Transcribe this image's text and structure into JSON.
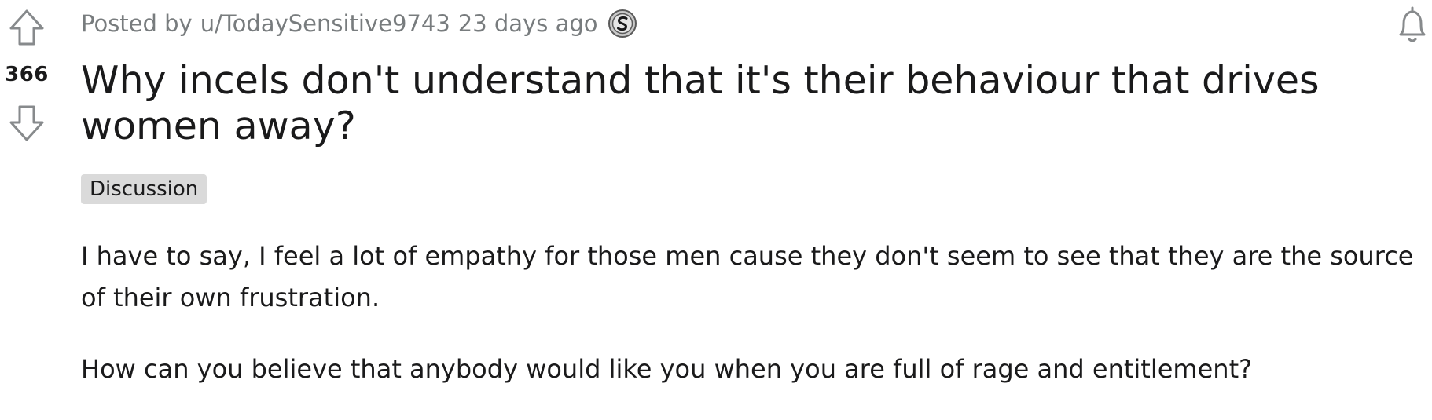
{
  "vote": {
    "score": "366",
    "upvote_icon": "arrow-up-outline-icon",
    "downvote_icon": "arrow-down-outline-icon"
  },
  "post": {
    "posted_by_prefix": "Posted by",
    "author": "u/TodaySensitive9743",
    "time": "23 days ago",
    "award_icon": "silver-coin-award-icon",
    "title": "Why incels don't understand that it's their behaviour that drives women away?",
    "flair": "Discussion",
    "body": [
      "I have to say, I feel a lot of empathy for those men cause they don't seem to see that they are the source of their own frustration.",
      "How can you believe that anybody would like you when you are full of rage and entitlement?"
    ]
  },
  "actions": {
    "notification_icon": "bell-icon"
  },
  "colors": {
    "meta_text": "#787c7e",
    "primary_text": "#1a1a1b",
    "flair_bg": "#dadada",
    "icon_stroke": "#878a8c"
  }
}
